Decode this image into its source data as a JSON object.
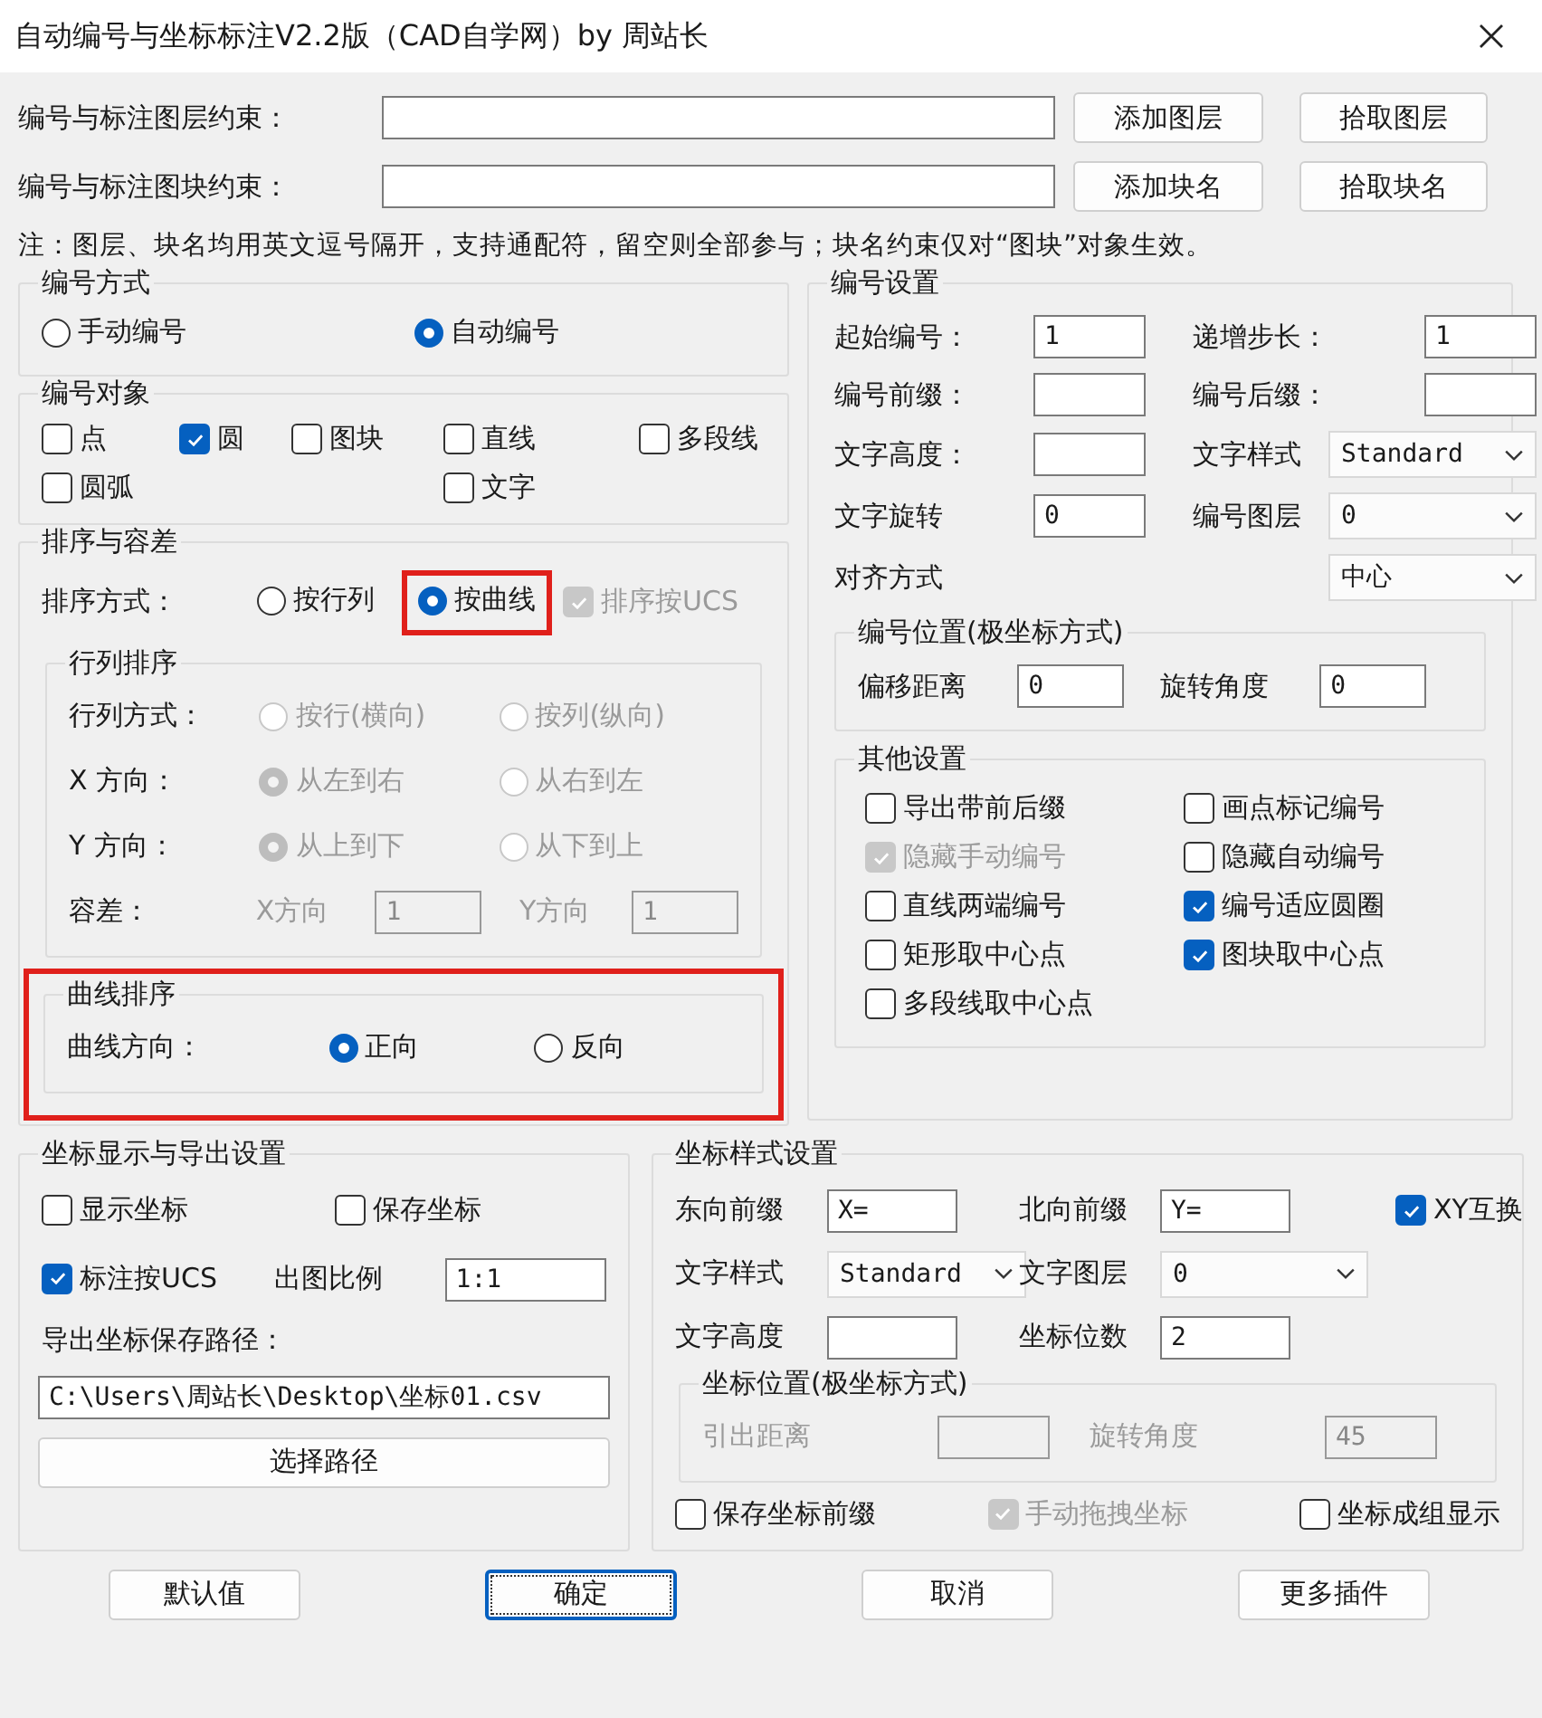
{
  "window": {
    "title": "自动编号与坐标标注V2.2版（CAD自学网）by 周站长"
  },
  "constraints": [
    {
      "label": "编号与标注图层约束：",
      "buttons": [
        "添加图层",
        "拾取图层"
      ]
    },
    {
      "label": "编号与标注图块约束：",
      "buttons": [
        "添加块名",
        "拾取块名"
      ]
    }
  ],
  "note": "注：图层、块名均用英文逗号隔开，支持通配符，留空则全部参与；块名约束仅对“图块”对象生效。",
  "numbering_mode": {
    "title": "编号方式",
    "options": [
      {
        "label": "手动编号",
        "selected": false
      },
      {
        "label": "自动编号",
        "selected": true
      }
    ]
  },
  "numbering_objects": {
    "title": "编号对象",
    "rows": [
      [
        {
          "label": "点",
          "checked": false
        },
        {
          "label": "圆",
          "checked": true
        },
        {
          "label": "图块",
          "checked": false
        },
        {
          "label": "直线",
          "checked": false
        },
        {
          "label": "多段线",
          "checked": false
        }
      ],
      [
        {
          "label": "圆弧",
          "checked": false
        },
        "",
        "",
        {
          "label": "文字",
          "checked": false
        }
      ]
    ]
  },
  "sorting": {
    "title": "排序与容差",
    "method_label": "排序方式：",
    "methods": [
      {
        "label": "按行列",
        "selected": false,
        "highlighted": false
      },
      {
        "label": "按曲线",
        "selected": true,
        "highlighted": true
      }
    ],
    "ucs": {
      "label": "排序按UCS",
      "checked": true,
      "disabled": true
    },
    "row_column": {
      "title": "行列排序",
      "rows": [
        {
          "label": "行列方式：",
          "options": [
            {
              "label": "按行(横向)",
              "selected": false,
              "disabled": true
            },
            {
              "label": "按列(纵向)",
              "selected": false,
              "disabled": true
            }
          ]
        },
        {
          "label": "X 方向：",
          "options": [
            {
              "label": "从左到右",
              "selected": true,
              "disabled": true
            },
            {
              "label": "从右到左",
              "selected": false,
              "disabled": true
            }
          ]
        },
        {
          "label": "Y 方向：",
          "options": [
            {
              "label": "从上到下",
              "selected": true,
              "disabled": true
            },
            {
              "label": "从下到上",
              "selected": false,
              "disabled": true
            }
          ]
        }
      ],
      "tolerance": {
        "label": "容差：",
        "x_label": "X方向",
        "x_value": "1",
        "y_label": "Y方向",
        "y_value": "1",
        "disabled": true
      }
    },
    "curve": {
      "title": "曲线排序",
      "highlighted": true,
      "label": "曲线方向：",
      "options": [
        {
          "label": "正向",
          "selected": true
        },
        {
          "label": "反向",
          "selected": false
        }
      ]
    }
  },
  "number_settings": {
    "title": "编号设置",
    "rows": [
      [
        {
          "label": "起始编号：",
          "kind": "input",
          "value": "1"
        },
        {
          "label": "递增步长：",
          "kind": "input",
          "value": "1"
        }
      ],
      [
        {
          "label": "编号前缀：",
          "kind": "input"
        },
        {
          "label": "编号后缀：",
          "kind": "input"
        }
      ],
      [
        {
          "label": "文字高度：",
          "kind": "input"
        },
        {
          "label": "文字样式",
          "kind": "select",
          "value": "Standard"
        }
      ],
      [
        {
          "label": "文字旋转",
          "kind": "input",
          "value": "0"
        },
        {
          "label": "编号图层",
          "kind": "select",
          "value": "0"
        }
      ],
      [
        {
          "label": "对齐方式",
          "kind": "select",
          "value": "中心"
        }
      ]
    ],
    "position": {
      "title": "编号位置(极坐标方式)",
      "fields": [
        {
          "label": "偏移距离",
          "value": "0"
        },
        {
          "label": "旋转角度",
          "value": "0"
        }
      ]
    },
    "other": {
      "title": "其他设置",
      "items": [
        {
          "label": "导出带前后缀",
          "checked": false,
          "disabled": false
        },
        {
          "label": "画点标记编号",
          "checked": false,
          "disabled": false
        },
        {
          "label": "隐藏手动编号",
          "checked": true,
          "disabled": true
        },
        {
          "label": "隐藏自动编号",
          "checked": false,
          "disabled": false
        },
        {
          "label": "直线两端编号",
          "checked": false,
          "disabled": false
        },
        {
          "label": "编号适应圆圈",
          "checked": true,
          "disabled": false
        },
        {
          "label": "矩形取中心点",
          "checked": false,
          "disabled": false
        },
        {
          "label": "图块取中心点",
          "checked": true,
          "disabled": false
        },
        {
          "label": "多段线取中心点",
          "checked": false,
          "disabled": false
        }
      ]
    }
  },
  "coord_export": {
    "title": "坐标显示与导出设置",
    "checks": [
      {
        "label": "显示坐标",
        "checked": false
      },
      {
        "label": "保存坐标",
        "checked": false
      },
      {
        "label": "标注按UCS",
        "checked": true
      }
    ],
    "scale_label": "出图比例",
    "scale_value": "1:1",
    "path_label": "导出坐标保存路径：",
    "path_value": "C:\\Users\\周站长\\Desktop\\坐标01.csv",
    "choose_button": "选择路径"
  },
  "coord_style": {
    "title": "坐标样式设置",
    "rows": [
      [
        {
          "label": "东向前缀",
          "kind": "input",
          "value": "X="
        },
        {
          "label": "北向前缀",
          "kind": "input",
          "value": "Y="
        },
        {
          "label": "XY互换",
          "kind": "check",
          "checked": true
        }
      ],
      [
        {
          "label": "文字样式",
          "kind": "select",
          "value": "Standard"
        },
        {
          "label": "文字图层",
          "kind": "select",
          "value": "0"
        }
      ],
      [
        {
          "label": "文字高度",
          "kind": "input"
        },
        {
          "label": "坐标位数",
          "kind": "input",
          "value": "2"
        }
      ]
    ],
    "position": {
      "title": "坐标位置(极坐标方式)",
      "disabled": true,
      "fields": [
        {
          "label": "引出距离"
        },
        {
          "label": "旋转角度",
          "value": "45"
        }
      ]
    },
    "checks": [
      {
        "label": "保存坐标前缀",
        "checked": false,
        "disabled": false
      },
      {
        "label": "手动拖拽坐标",
        "checked": true,
        "disabled": true
      },
      {
        "label": "坐标成组显示",
        "checked": false,
        "disabled": false
      }
    ]
  },
  "buttons": [
    {
      "label": "默认值",
      "default": false
    },
    {
      "label": "确定",
      "default": true
    },
    {
      "label": "取消",
      "default": false
    },
    {
      "label": "更多插件",
      "default": false
    }
  ]
}
